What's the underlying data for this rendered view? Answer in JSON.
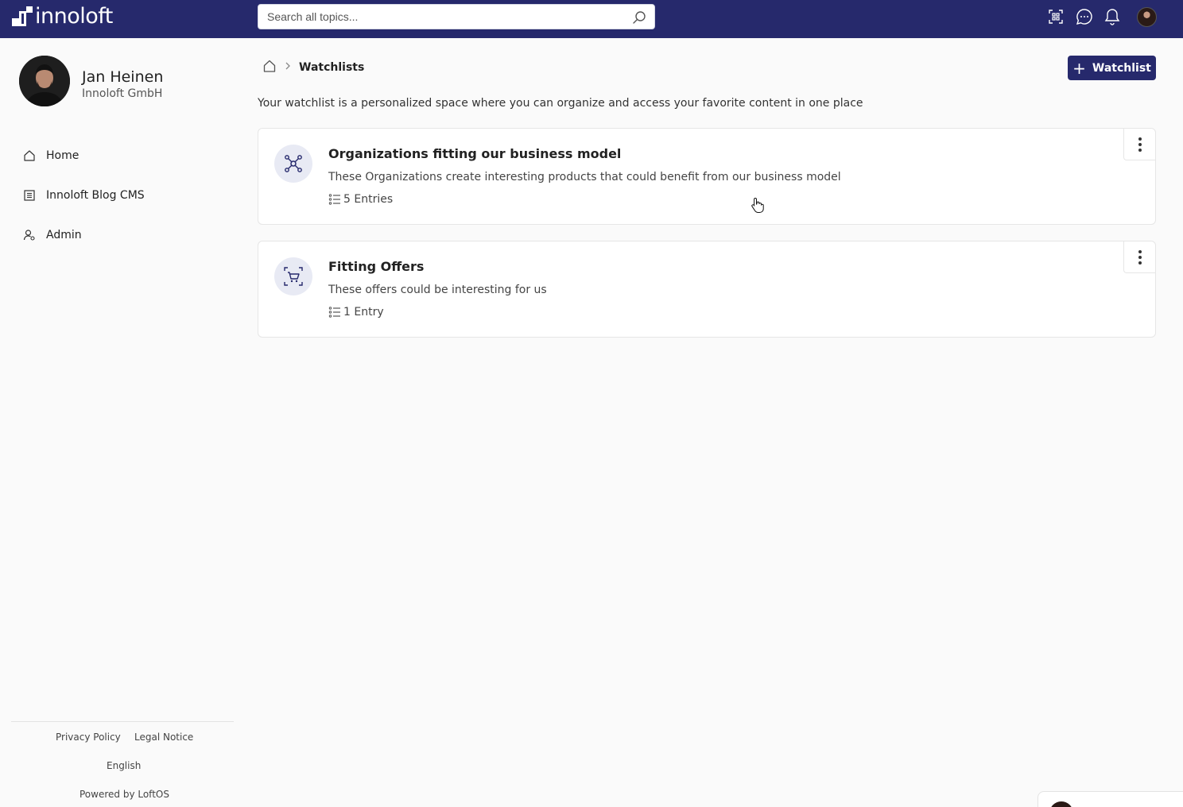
{
  "brand": {
    "name": "innoloft"
  },
  "search": {
    "placeholder": "Search all topics..."
  },
  "topbar": {
    "icons": [
      "qr-scan-icon",
      "chat-icon",
      "bell-icon"
    ]
  },
  "profile": {
    "name": "Jan Heinen",
    "organization": "Innoloft GmbH"
  },
  "sidebar": {
    "items": [
      {
        "label": "Home",
        "icon": "home-icon"
      },
      {
        "label": "Innoloft Blog CMS",
        "icon": "document-icon"
      },
      {
        "label": "Admin",
        "icon": "admin-user-icon"
      }
    ]
  },
  "footer": {
    "privacy": "Privacy Policy",
    "legal": "Legal Notice",
    "language": "English",
    "powered": "Powered by LoftOS"
  },
  "breadcrumb": {
    "current": "Watchlists"
  },
  "add_button": {
    "label": "Watchlist"
  },
  "intro": "Your watchlist is a personalized space where you can organize and access your favorite content in one place",
  "watchlists": [
    {
      "title": "Organizations fitting our business model",
      "description": "These Organizations create interesting products that could benefit from our business model",
      "count": "5 Entries",
      "icon": "network-icon"
    },
    {
      "title": "Fitting Offers",
      "description": "These offers could be interesting for us",
      "count": "1 Entry",
      "icon": "cart-icon"
    }
  ],
  "colors": {
    "primary": "#26296c",
    "icon_bg": "#e8eaf4"
  }
}
